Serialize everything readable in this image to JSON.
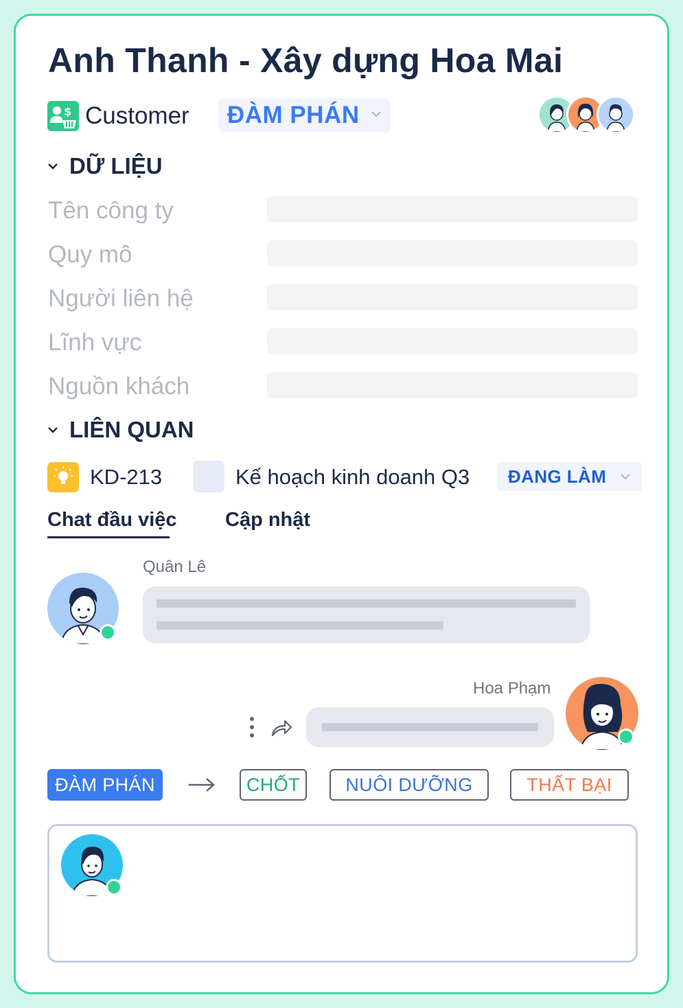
{
  "header": {
    "title": "Anh Thanh - Xây dựng Hoa Mai",
    "category_label": "Customer",
    "category_icon": "customer-money-icon",
    "stage_value": "ĐÀM PHÁN"
  },
  "sections": {
    "data_title": "DỮ LIỆU",
    "related_title": "LIÊN QUAN"
  },
  "fields": [
    {
      "label": "Tên công ty",
      "value": ""
    },
    {
      "label": "Quy mô",
      "value": ""
    },
    {
      "label": "Người liên hệ",
      "value": ""
    },
    {
      "label": "Lĩnh vực",
      "value": ""
    },
    {
      "label": "Nguồn khách",
      "value": ""
    }
  ],
  "related_task": {
    "id": "KD-213",
    "name": "Kế hoạch kinh doanh Q3",
    "status": "ĐANG LÀM",
    "icon": "lightbulb-icon"
  },
  "tabs": [
    {
      "label": "Chat đầu việc",
      "active": true
    },
    {
      "label": "Cập nhật",
      "active": false
    }
  ],
  "messages": [
    {
      "sender": "Quân Lê",
      "side": "left"
    },
    {
      "sender": "Hoa Phạm",
      "side": "right"
    }
  ],
  "stage_flow": {
    "current": "ĐÀM PHÁN",
    "options": [
      "CHỐT",
      "NUÔI DƯỠNG",
      "THẤT BẠI"
    ]
  },
  "colors": {
    "accent": "#3a7bf0",
    "success": "#1faa82",
    "nurture": "#3b72d9",
    "fail": "#f2784b",
    "online": "#2fd596",
    "frame": "#3ddaa6"
  }
}
